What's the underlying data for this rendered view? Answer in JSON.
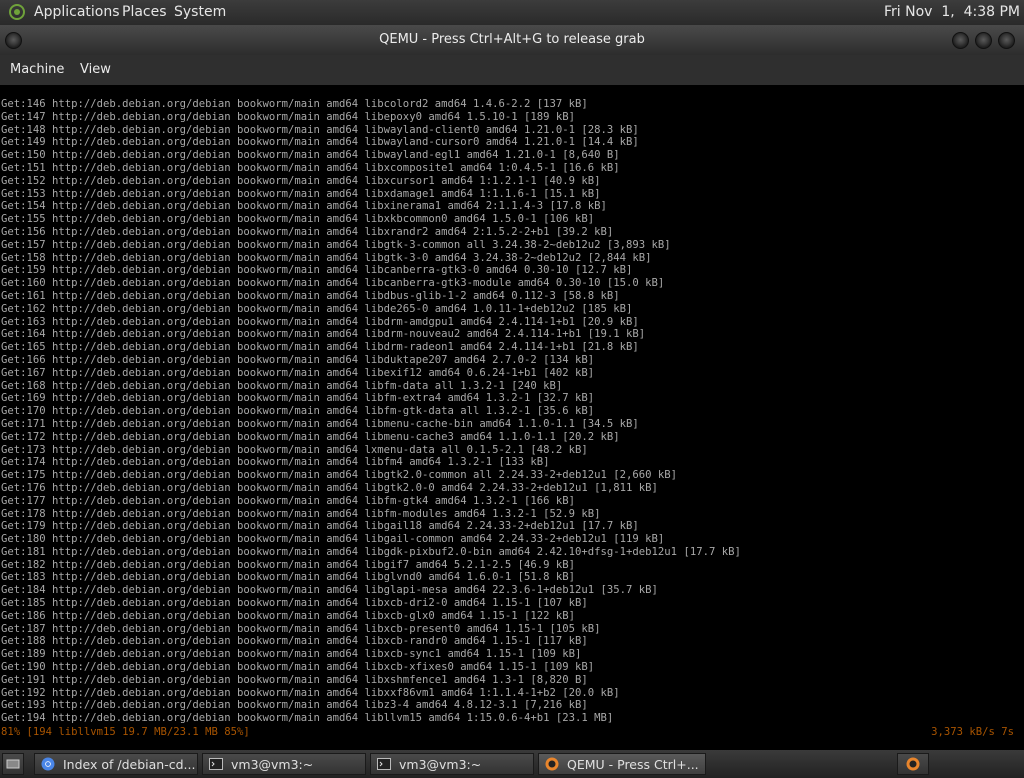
{
  "top_panel": {
    "menus": [
      "Applications",
      "Places",
      "System"
    ],
    "clock": "Fri Nov  1,  4:38 PM"
  },
  "window": {
    "title": "QEMU - Press Ctrl+Alt+G to release grab",
    "menus": [
      "Machine",
      "View"
    ]
  },
  "terminal": {
    "lines": [
      "Get:146 http://deb.debian.org/debian bookworm/main amd64 libcolord2 amd64 1.4.6-2.2 [137 kB]",
      "Get:147 http://deb.debian.org/debian bookworm/main amd64 libepoxy0 amd64 1.5.10-1 [189 kB]",
      "Get:148 http://deb.debian.org/debian bookworm/main amd64 libwayland-client0 amd64 1.21.0-1 [28.3 kB]",
      "Get:149 http://deb.debian.org/debian bookworm/main amd64 libwayland-cursor0 amd64 1.21.0-1 [14.4 kB]",
      "Get:150 http://deb.debian.org/debian bookworm/main amd64 libwayland-egl1 amd64 1.21.0-1 [8,640 B]",
      "Get:151 http://deb.debian.org/debian bookworm/main amd64 libxcomposite1 amd64 1:0.4.5-1 [16.6 kB]",
      "Get:152 http://deb.debian.org/debian bookworm/main amd64 libxcursor1 amd64 1:1.2.1-1 [40.9 kB]",
      "Get:153 http://deb.debian.org/debian bookworm/main amd64 libxdamage1 amd64 1:1.1.6-1 [15.1 kB]",
      "Get:154 http://deb.debian.org/debian bookworm/main amd64 libxinerama1 amd64 2:1.1.4-3 [17.8 kB]",
      "Get:155 http://deb.debian.org/debian bookworm/main amd64 libxkbcommon0 amd64 1.5.0-1 [106 kB]",
      "Get:156 http://deb.debian.org/debian bookworm/main amd64 libxrandr2 amd64 2:1.5.2-2+b1 [39.2 kB]",
      "Get:157 http://deb.debian.org/debian bookworm/main amd64 libgtk-3-common all 3.24.38-2~deb12u2 [3,893 kB]",
      "Get:158 http://deb.debian.org/debian bookworm/main amd64 libgtk-3-0 amd64 3.24.38-2~deb12u2 [2,844 kB]",
      "Get:159 http://deb.debian.org/debian bookworm/main amd64 libcanberra-gtk3-0 amd64 0.30-10 [12.7 kB]",
      "Get:160 http://deb.debian.org/debian bookworm/main amd64 libcanberra-gtk3-module amd64 0.30-10 [15.0 kB]",
      "Get:161 http://deb.debian.org/debian bookworm/main amd64 libdbus-glib-1-2 amd64 0.112-3 [58.8 kB]",
      "Get:162 http://deb.debian.org/debian bookworm/main amd64 libde265-0 amd64 1.0.11-1+deb12u2 [185 kB]",
      "Get:163 http://deb.debian.org/debian bookworm/main amd64 libdrm-amdgpu1 amd64 2.4.114-1+b1 [20.9 kB]",
      "Get:164 http://deb.debian.org/debian bookworm/main amd64 libdrm-nouveau2 amd64 2.4.114-1+b1 [19.1 kB]",
      "Get:165 http://deb.debian.org/debian bookworm/main amd64 libdrm-radeon1 amd64 2.4.114-1+b1 [21.8 kB]",
      "Get:166 http://deb.debian.org/debian bookworm/main amd64 libduktape207 amd64 2.7.0-2 [134 kB]",
      "Get:167 http://deb.debian.org/debian bookworm/main amd64 libexif12 amd64 0.6.24-1+b1 [402 kB]",
      "Get:168 http://deb.debian.org/debian bookworm/main amd64 libfm-data all 1.3.2-1 [240 kB]",
      "Get:169 http://deb.debian.org/debian bookworm/main amd64 libfm-extra4 amd64 1.3.2-1 [32.7 kB]",
      "Get:170 http://deb.debian.org/debian bookworm/main amd64 libfm-gtk-data all 1.3.2-1 [35.6 kB]",
      "Get:171 http://deb.debian.org/debian bookworm/main amd64 libmenu-cache-bin amd64 1.1.0-1.1 [34.5 kB]",
      "Get:172 http://deb.debian.org/debian bookworm/main amd64 libmenu-cache3 amd64 1.1.0-1.1 [20.2 kB]",
      "Get:173 http://deb.debian.org/debian bookworm/main amd64 lxmenu-data all 0.1.5-2.1 [48.2 kB]",
      "Get:174 http://deb.debian.org/debian bookworm/main amd64 libfm4 amd64 1.3.2-1 [133 kB]",
      "Get:175 http://deb.debian.org/debian bookworm/main amd64 libgtk2.0-common all 2.24.33-2+deb12u1 [2,660 kB]",
      "Get:176 http://deb.debian.org/debian bookworm/main amd64 libgtk2.0-0 amd64 2.24.33-2+deb12u1 [1,811 kB]",
      "Get:177 http://deb.debian.org/debian bookworm/main amd64 libfm-gtk4 amd64 1.3.2-1 [166 kB]",
      "Get:178 http://deb.debian.org/debian bookworm/main amd64 libfm-modules amd64 1.3.2-1 [52.9 kB]",
      "Get:179 http://deb.debian.org/debian bookworm/main amd64 libgail18 amd64 2.24.33-2+deb12u1 [17.7 kB]",
      "Get:180 http://deb.debian.org/debian bookworm/main amd64 libgail-common amd64 2.24.33-2+deb12u1 [119 kB]",
      "Get:181 http://deb.debian.org/debian bookworm/main amd64 libgdk-pixbuf2.0-bin amd64 2.42.10+dfsg-1+deb12u1 [17.7 kB]",
      "Get:182 http://deb.debian.org/debian bookworm/main amd64 libgif7 amd64 5.2.1-2.5 [46.9 kB]",
      "Get:183 http://deb.debian.org/debian bookworm/main amd64 libglvnd0 amd64 1.6.0-1 [51.8 kB]",
      "Get:184 http://deb.debian.org/debian bookworm/main amd64 libglapi-mesa amd64 22.3.6-1+deb12u1 [35.7 kB]",
      "Get:185 http://deb.debian.org/debian bookworm/main amd64 libxcb-dri2-0 amd64 1.15-1 [107 kB]",
      "Get:186 http://deb.debian.org/debian bookworm/main amd64 libxcb-glx0 amd64 1.15-1 [122 kB]",
      "Get:187 http://deb.debian.org/debian bookworm/main amd64 libxcb-present0 amd64 1.15-1 [105 kB]",
      "Get:188 http://deb.debian.org/debian bookworm/main amd64 libxcb-randr0 amd64 1.15-1 [117 kB]",
      "Get:189 http://deb.debian.org/debian bookworm/main amd64 libxcb-sync1 amd64 1.15-1 [109 kB]",
      "Get:190 http://deb.debian.org/debian bookworm/main amd64 libxcb-xfixes0 amd64 1.15-1 [109 kB]",
      "Get:191 http://deb.debian.org/debian bookworm/main amd64 libxshmfence1 amd64 1.3-1 [8,820 B]",
      "Get:192 http://deb.debian.org/debian bookworm/main amd64 libxxf86vm1 amd64 1:1.1.4-1+b2 [20.0 kB]",
      "Get:193 http://deb.debian.org/debian bookworm/main amd64 libz3-4 amd64 4.8.12-3.1 [7,216 kB]",
      "Get:194 http://deb.debian.org/debian bookworm/main amd64 libllvm15 amd64 1:15.0.6-4+b1 [23.1 MB]"
    ],
    "progress_line": "81% [194 libllvm15 19.7 MB/23.1 MB 85%]",
    "speed": "3,373 kB/s 7s",
    "progress_color": "#a85400"
  },
  "taskbar": {
    "items": [
      {
        "label": "Index of /debian-cd...",
        "icon": "chromium-icon"
      },
      {
        "label": "vm3@vm3:~",
        "icon": "terminal-icon"
      },
      {
        "label": "vm3@vm3:~",
        "icon": "terminal-icon"
      },
      {
        "label": "QEMU - Press Ctrl+...",
        "icon": "qemu-icon"
      }
    ]
  }
}
